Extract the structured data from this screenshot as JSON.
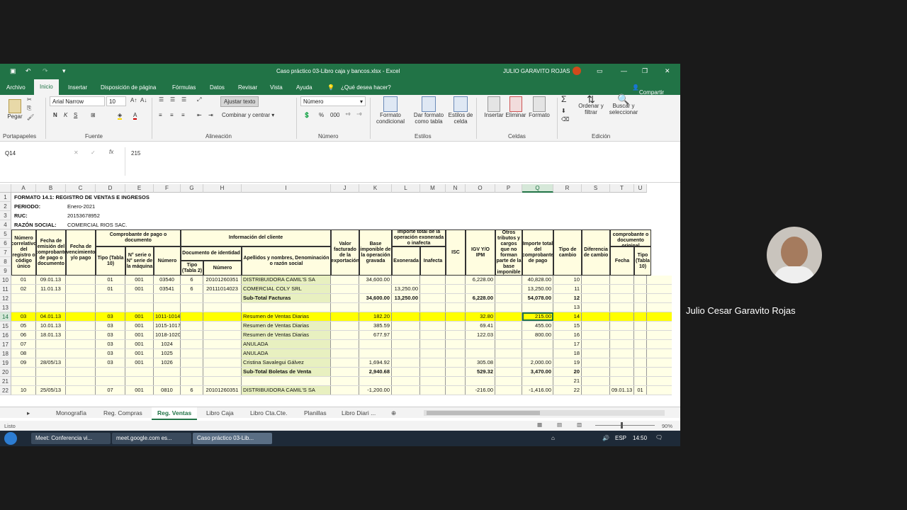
{
  "window": {
    "title": "Caso práctico 03-Libro caja y bancos.xlsx - Excel",
    "user": "JULIO GARAVITO ROJAS"
  },
  "menu": [
    "Archivo",
    "Inicio",
    "Insertar",
    "Disposición de página",
    "Fórmulas",
    "Datos",
    "Revisar",
    "Vista",
    "Ayuda",
    "¿Qué desea hacer?",
    "Compartir"
  ],
  "ribbon": {
    "paste": "Pegar",
    "font_name": "Arial Narrow",
    "font_size": "10",
    "wrap": "Ajustar texto",
    "merge": "Combinar y centrar",
    "number_format": "Número",
    "cond_format": "Formato condicional",
    "table_format": "Dar formato como tabla",
    "cell_styles": "Estilos de celda",
    "insert": "Insertar",
    "delete": "Eliminar",
    "format": "Formato",
    "sort": "Ordenar y filtrar",
    "find": "Buscar y seleccionar",
    "groups": [
      "Portapapeles",
      "Fuente",
      "Alineación",
      "Número",
      "Estilos",
      "Celdas",
      "Edición"
    ]
  },
  "formula_bar": {
    "name_box": "Q14",
    "value": "215"
  },
  "columns": [
    "A",
    "B",
    "C",
    "D",
    "E",
    "F",
    "G",
    "H",
    "I",
    "J",
    "K",
    "L",
    "M",
    "N",
    "O",
    "P",
    "Q",
    "R",
    "S",
    "T",
    "U"
  ],
  "rows": [
    "1",
    "2",
    "3",
    "4",
    "5",
    "6",
    "7",
    "8",
    "9",
    "10",
    "11",
    "12",
    "13",
    "14",
    "15",
    "16",
    "17",
    "18",
    "19",
    "20",
    "21",
    "22"
  ],
  "info": {
    "title": "FORMATO 14.1: REGISTRO DE VENTAS E INGRESOS",
    "periodo_label": "PERIODO:",
    "periodo": "Enero-2021",
    "ruc_label": "RUC:",
    "ruc": "20153678952",
    "razon_label": "RAZÓN SOCIAL:",
    "razon": "COMERCIAL RIOS SAC."
  },
  "headers": {
    "a": "Número correlativo del registro o código único",
    "b": "Fecha de emisión del comprobante de pago o documento",
    "c": "Fecha de vencimiento y/o pago",
    "comp": "Comprobante de pago o documento",
    "tipo": "Tipo (Tabla 10)",
    "serie": "N° serie o N° serie de la máquina",
    "numero": "Número",
    "cliente": "Información del cliente",
    "docid": "Documento de identidad",
    "tipo2": "Tipo (Tabla 2)",
    "num2": "Número",
    "apellidos": "Apellidos y nombres, Denominación o razón social",
    "valor": "Valor facturado de la exportación",
    "base": "Base imponible de la operación gravada",
    "importe_exo": "Importe total de la operación exonerada o inafecta",
    "exonerada": "Exonerada",
    "inafecta": "Inafecta",
    "isc": "ISC",
    "igv": "IGV Y/O IPM",
    "otros": "Otros tributos y cargos que no forman parte de la base imponible",
    "total": "Importe total del comprobante de pago",
    "tcambio": "Tipo de cambio",
    "diferencia": "Diferencia de cambio",
    "ref": "Referencia del comprobante o documento original",
    "fecha": "Fecha",
    "tipo3": "Tipo (Tabla 10)"
  },
  "data_rows": [
    {
      "r": "10",
      "a": "01",
      "b": "09.01.13",
      "d": "01",
      "e": "001",
      "f": "03540",
      "g": "6",
      "h": "20101260351",
      "i": "DISTRIBUIDORA CAMIL'S SA",
      "k": "34,600.00",
      "l": "",
      "o": "6,228.00",
      "q": "40,828.00",
      "t": "",
      "u": "",
      "hl": false,
      "bold": false
    },
    {
      "r": "11",
      "a": "02",
      "b": "11.01.13",
      "d": "01",
      "e": "001",
      "f": "03541",
      "g": "6",
      "h": "20111014023",
      "i": "COMERCIAL COLY SRL",
      "k": "",
      "l": "13,250.00",
      "o": "",
      "q": "13,250.00",
      "t": "",
      "u": "",
      "hl": false,
      "bold": false
    },
    {
      "r": "12",
      "a": "",
      "b": "",
      "d": "",
      "e": "",
      "f": "",
      "g": "",
      "h": "",
      "i": "Sub-Total Facturas",
      "k": "34,600.00",
      "l": "13,250.00",
      "o": "6,228.00",
      "q": "54,078.00",
      "t": "",
      "u": "",
      "hl": false,
      "bold": true
    },
    {
      "r": "13",
      "a": "",
      "b": "",
      "d": "",
      "e": "",
      "f": "",
      "g": "",
      "h": "",
      "i": "",
      "k": "",
      "l": "",
      "o": "",
      "q": "",
      "t": "",
      "u": "",
      "hl": false,
      "bold": false
    },
    {
      "r": "14",
      "a": "03",
      "b": "04.01.13",
      "d": "03",
      "e": "001",
      "f": "1011-1014",
      "g": "",
      "h": "",
      "i": "Resumen de Ventas Diarias",
      "k": "182.20",
      "l": "",
      "o": "32.80",
      "q": "215.00",
      "t": "",
      "u": "",
      "hl": true,
      "bold": false
    },
    {
      "r": "15",
      "a": "05",
      "b": "10.01.13",
      "d": "03",
      "e": "001",
      "f": "1015-1017",
      "g": "",
      "h": "",
      "i": "Resumen de Ventas Diarias",
      "k": "385.59",
      "l": "",
      "o": "69.41",
      "q": "455.00",
      "t": "",
      "u": "",
      "hl": false,
      "bold": false
    },
    {
      "r": "16",
      "a": "06",
      "b": "18.01.13",
      "d": "03",
      "e": "001",
      "f": "1018-1020",
      "g": "",
      "h": "",
      "i": "Resumen de Ventas Diarias",
      "k": "677.97",
      "l": "",
      "o": "122.03",
      "q": "800.00",
      "t": "",
      "u": "",
      "hl": false,
      "bold": false
    },
    {
      "r": "17",
      "a": "07",
      "b": "",
      "d": "03",
      "e": "001",
      "f": "1024",
      "g": "",
      "h": "",
      "i": "ANULADA",
      "k": "",
      "l": "",
      "o": "",
      "q": "",
      "t": "",
      "u": "",
      "hl": false,
      "bold": false
    },
    {
      "r": "18",
      "a": "08",
      "b": "",
      "d": "03",
      "e": "001",
      "f": "1025",
      "g": "",
      "h": "",
      "i": "ANULADA",
      "k": "",
      "l": "",
      "o": "",
      "q": "",
      "t": "",
      "u": "",
      "hl": false,
      "bold": false
    },
    {
      "r": "19",
      "a": "09",
      "b": "28/05/13",
      "d": "03",
      "e": "001",
      "f": "1026",
      "g": "",
      "h": "",
      "i": "Cristina Savalegui Gálvez",
      "k": "1,694.92",
      "l": "",
      "o": "305.08",
      "q": "2,000.00",
      "t": "",
      "u": "",
      "hl": false,
      "bold": false
    },
    {
      "r": "20",
      "a": "",
      "b": "",
      "d": "",
      "e": "",
      "f": "",
      "g": "",
      "h": "",
      "i": "Sub-Total Boletas de Venta",
      "k": "2,940.68",
      "l": "",
      "o": "529.32",
      "q": "3,470.00",
      "t": "",
      "u": "",
      "hl": false,
      "bold": true
    },
    {
      "r": "21",
      "a": "",
      "b": "",
      "d": "",
      "e": "",
      "f": "",
      "g": "",
      "h": "",
      "i": "",
      "k": "",
      "l": "",
      "o": "",
      "q": "",
      "t": "",
      "u": "",
      "hl": false,
      "bold": false
    },
    {
      "r": "22",
      "a": "10",
      "b": "25/05/13",
      "d": "07",
      "e": "001",
      "f": "0810",
      "g": "6",
      "h": "20101260351",
      "i": "DISTRIBUIDORA CAMIL'S SA",
      "k": "-1,200.00",
      "l": "",
      "o": "-216.00",
      "q": "-1,416.00",
      "t": "09.01.13",
      "u": "01",
      "hl": false,
      "bold": false
    }
  ],
  "sheets": [
    "Monografía",
    "Reg. Compras",
    "Reg. Ventas",
    "Libro Caja",
    "Libro Cta.Cte.",
    "Planillas",
    "Libro Diari ..."
  ],
  "status": {
    "ready": "Listo",
    "zoom": "90%"
  },
  "taskbar": {
    "items": [
      "Meet: Conferencia vi...",
      "meet.google.com es...",
      "Caso práctico 03-Lib..."
    ],
    "lang": "ESP",
    "time": "14:50"
  },
  "participant": "Julio Cesar Garavito Rojas"
}
